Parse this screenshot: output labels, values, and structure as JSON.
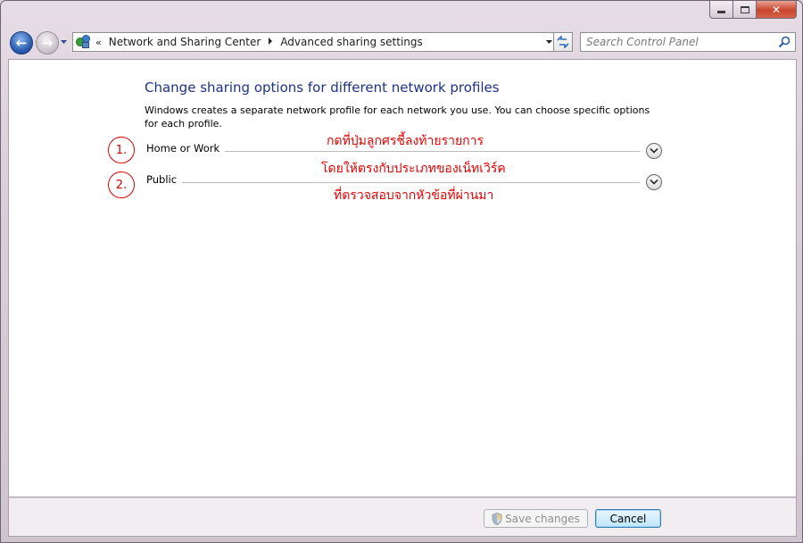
{
  "window": {
    "caption_buttons": {
      "minimize": "minimize",
      "maximize": "maximize",
      "close": "✕"
    }
  },
  "nav": {
    "back_icon": "←",
    "forward_icon": "→",
    "breadcrumb_chevron": "«",
    "breadcrumbs": [
      "Network and Sharing Center",
      "Advanced sharing settings"
    ],
    "search_placeholder": "Search Control Panel"
  },
  "main": {
    "title": "Change sharing options for different network profiles",
    "description": "Windows creates a separate network profile for each network you use. You can choose specific options for each profile.",
    "profiles": [
      {
        "number": "1.",
        "label": "Home or Work"
      },
      {
        "number": "2.",
        "label": "Public"
      }
    ],
    "annotations": [
      "กดที่ปุ่มลูกศรชี้ลงท้ายรายการ",
      "โดยให้ตรงกับประเภทของเน็ทเวิร์ค",
      "ที่ตรวจสอบจากหัวข้อที่ผ่านมา"
    ],
    "annotation_color": "#e00000",
    "title_color": "#1e3287"
  },
  "footer": {
    "save_label": "Save changes",
    "cancel_label": "Cancel"
  }
}
